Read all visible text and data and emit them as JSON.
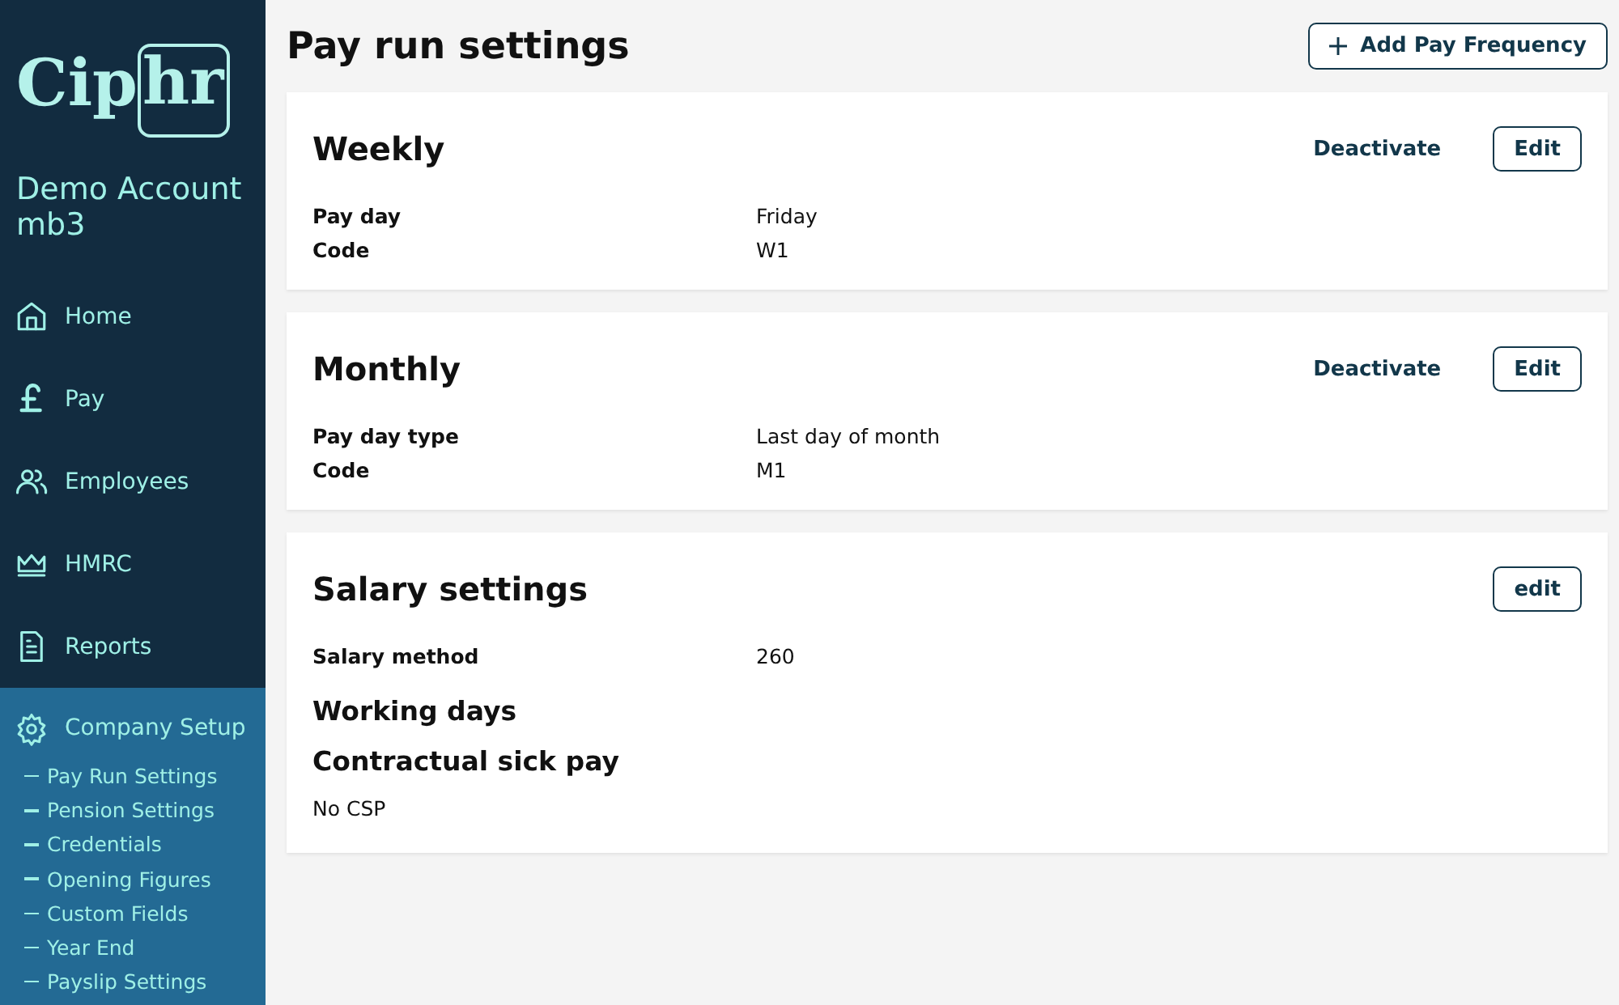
{
  "sidebar": {
    "logo_text": "Cip",
    "logo_boxed_text": "hr",
    "account_name": "Demo Account mb3",
    "items": [
      {
        "label": "Home",
        "kind": "home",
        "selected": false
      },
      {
        "label": "Pay",
        "kind": "pound",
        "selected": false
      },
      {
        "label": "Employees",
        "kind": "people",
        "selected": false
      },
      {
        "label": "HMRC",
        "kind": "crown",
        "selected": false
      },
      {
        "label": "Reports",
        "kind": "document",
        "selected": false
      },
      {
        "label": "Company Setup",
        "kind": "gear",
        "selected": true,
        "children": [
          "Pay Run Settings",
          "Pension Settings",
          "Credentials",
          "Opening Figures",
          "Custom Fields",
          "Year End",
          "Payslip Settings"
        ]
      }
    ]
  },
  "page": {
    "title": "Pay run settings",
    "add_button": "Add Pay Frequency"
  },
  "frequencies": [
    {
      "title": "Weekly",
      "deactivate": "Deactivate",
      "edit": "Edit",
      "fields": [
        {
          "label": "Pay day",
          "value": "Friday"
        },
        {
          "label": "Code",
          "value": "W1"
        }
      ]
    },
    {
      "title": "Monthly",
      "deactivate": "Deactivate",
      "edit": "Edit",
      "fields": [
        {
          "label": "Pay day type",
          "value": "Last day of month"
        },
        {
          "label": "Code",
          "value": "M1"
        }
      ]
    }
  ],
  "salary": {
    "title": "Salary settings",
    "edit": "edit",
    "fields": [
      {
        "label": "Salary method",
        "value": "260"
      }
    ],
    "working_days_heading": "Working days",
    "sick_pay_heading": "Contractual sick pay",
    "sick_pay_value": "No CSP"
  }
}
